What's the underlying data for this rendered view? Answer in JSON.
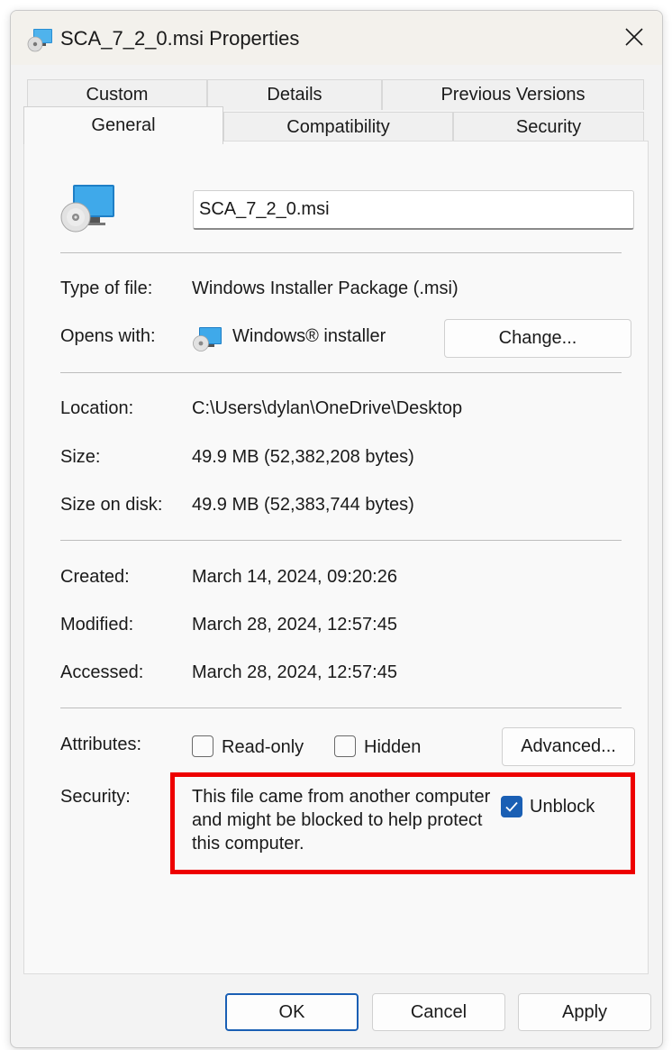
{
  "window": {
    "title": "SCA_7_2_0.msi Properties",
    "close_icon": "close-icon"
  },
  "tabs": {
    "row1": [
      "Custom",
      "Details",
      "Previous Versions"
    ],
    "row2": [
      "General",
      "Compatibility",
      "Security"
    ],
    "active": "General"
  },
  "general": {
    "file_name": "SCA_7_2_0.msi",
    "type_label": "Type of file:",
    "type_value": "Windows Installer Package (.msi)",
    "opens_label": "Opens with:",
    "opens_value": "Windows® installer",
    "change_button": "Change...",
    "location_label": "Location:",
    "location_value": "C:\\Users\\dylan\\OneDrive\\Desktop",
    "size_label": "Size:",
    "size_value": "49.9 MB (52,382,208 bytes)",
    "size_disk_label": "Size on disk:",
    "size_disk_value": "49.9 MB (52,383,744 bytes)",
    "created_label": "Created:",
    "created_value": "March 14, 2024, 09:20:26",
    "modified_label": "Modified:",
    "modified_value": "March 28, 2024, 12:57:45",
    "accessed_label": "Accessed:",
    "accessed_value": "March 28, 2024, 12:57:45",
    "attributes_label": "Attributes:",
    "readonly_label": "Read-only",
    "readonly_checked": false,
    "hidden_label": "Hidden",
    "hidden_checked": false,
    "advanced_button": "Advanced...",
    "security_label": "Security:",
    "security_text": "This file came from another computer and might be blocked to help protect this computer.",
    "unblock_label": "Unblock",
    "unblock_checked": true
  },
  "footer": {
    "ok": "OK",
    "cancel": "Cancel",
    "apply": "Apply"
  },
  "colors": {
    "accent": "#1a5fb4",
    "highlight": "#ee0000"
  }
}
